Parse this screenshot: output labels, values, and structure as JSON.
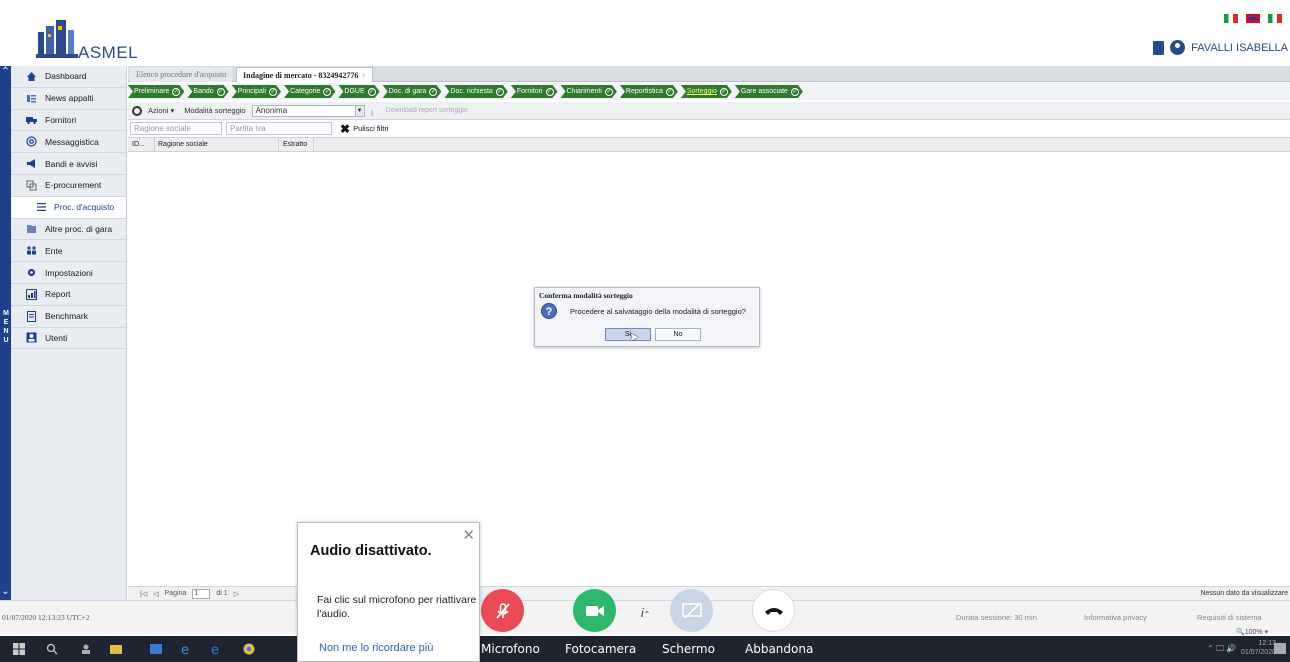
{
  "header": {
    "logo_text": "ASMEL",
    "user_name": "FAVALLI ISABELLA",
    "flags": [
      "it",
      "gb",
      "it-2"
    ]
  },
  "rail": {
    "label": "M E N U"
  },
  "sidebar": {
    "items": [
      {
        "label": "Dashboard",
        "icon": "home-icon"
      },
      {
        "label": "News appalti",
        "icon": "news-icon"
      },
      {
        "label": "Fornitori",
        "icon": "truck-icon"
      },
      {
        "label": "Messaggistica",
        "icon": "at-icon"
      },
      {
        "label": "Bandi e avvisi",
        "icon": "megaphone-icon"
      },
      {
        "label": "E-procurement",
        "icon": "procurement-icon"
      },
      {
        "label": "Proc. d'acquisto",
        "icon": "list-icon"
      },
      {
        "label": "Altre proc. di gara",
        "icon": "folder-icon"
      },
      {
        "label": "Ente",
        "icon": "people-icon"
      },
      {
        "label": "Impostazioni",
        "icon": "gear-icon"
      },
      {
        "label": "Report",
        "icon": "chart-icon"
      },
      {
        "label": "Benchmark",
        "icon": "doc-icon"
      },
      {
        "label": "Utenti",
        "icon": "user-icon"
      }
    ]
  },
  "tabs": {
    "tab1": "Elenco procedure d'acquisto",
    "tab2": "Indagine di mercato - 8324942776",
    "close": "×"
  },
  "wizard": {
    "steps": [
      "Preliminare",
      "Bando",
      "Principali",
      "Categorie",
      "DGUE",
      "Doc. di gara",
      "Doc. richiesta",
      "Fornitori",
      "Chiarimenti",
      "Reportistica",
      "Sorteggio",
      "Gare associate"
    ],
    "active_step": "Sorteggio"
  },
  "toolbar": {
    "azioni": "Azioni",
    "modalita_label": "Modalità sorteggio",
    "modalita_value": "Anonima",
    "download": "Download report sorteggio"
  },
  "filters": {
    "ragione_sociale": "Ragione sociale",
    "partita_iva": "Partita iva",
    "clear": "Pulisci filtri"
  },
  "grid": {
    "columns": [
      "ID...",
      "Ragione sociale",
      "Estratto"
    ]
  },
  "pager": {
    "page_label": "Pagina",
    "page_value": "1",
    "of": "di 1",
    "empty": "Nessun dato da visualizzare"
  },
  "dialog": {
    "title": "Conferma modalità sorteggio",
    "message": "Procedere al salvataggio della modalità di sorteggio?",
    "yes": "Si",
    "no": "No"
  },
  "meeting": {
    "timestamp": "01/07/2020 12:13:23 UTC+2",
    "session": "Durata sessione: 30 min",
    "privacy": "Informativa privacy",
    "requisiti": "Requisiti di sistema",
    "zoom": "100%",
    "info": "i",
    "labels": [
      "Microfono",
      "Fotocamera",
      "Schermo",
      "Abbandona"
    ]
  },
  "popup": {
    "title": "Audio disattivato.",
    "body": "Fai clic sul microfono per riattivare l'audio.",
    "link": "Non me lo ricordare più"
  },
  "taskbar": {
    "time": "12:13",
    "date": "01/07/2020"
  },
  "colors": {
    "brand": "#2a4a8c",
    "step_green": "#2f7a2f",
    "mic_red": "#e94a55",
    "cam_green": "#2fb76c"
  }
}
